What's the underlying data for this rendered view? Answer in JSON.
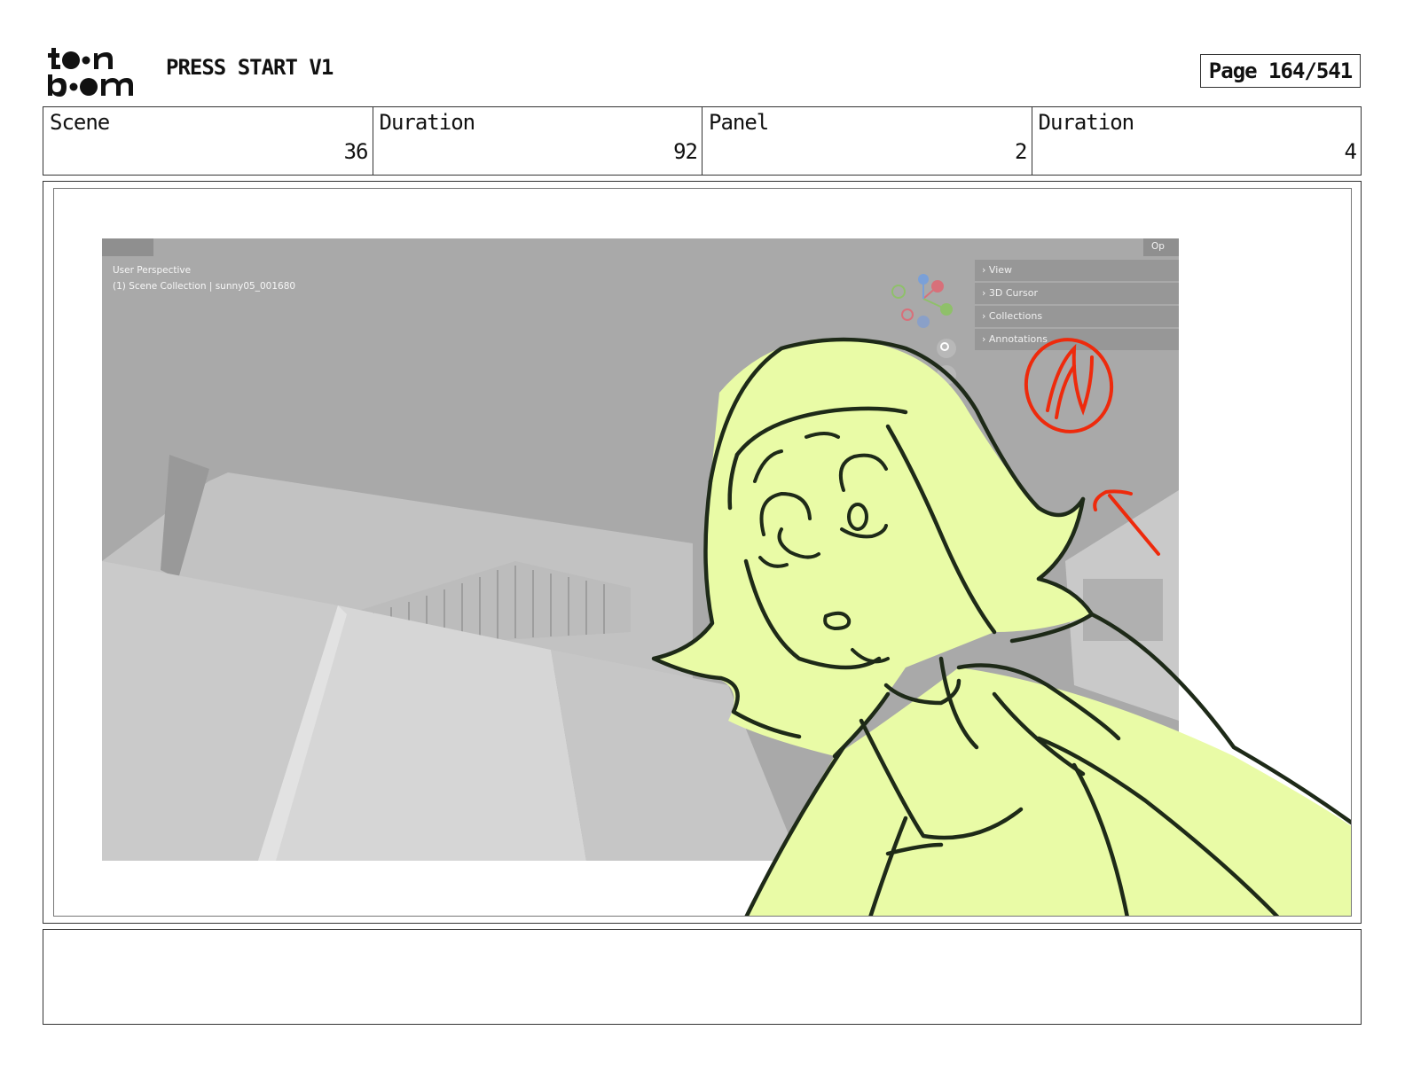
{
  "header": {
    "logo_text": "toon boom",
    "project_title": "PRESS START V1",
    "page_label": "Page 164/541"
  },
  "info": {
    "scene_label": "Scene",
    "scene_value": "36",
    "scene_duration_label": "Duration",
    "scene_duration_value": "92",
    "panel_label": "Panel",
    "panel_value": "2",
    "panel_duration_label": "Duration",
    "panel_duration_value": "4"
  },
  "viewport": {
    "perspective_label": "User Perspective",
    "collection_label": "(1) Scene Collection | sunny05_001680",
    "options_label": "Op",
    "sidebar_items": [
      "View",
      "3D Cursor",
      "Collections",
      "Annotations"
    ]
  },
  "colors": {
    "character_fill": "#e9fba6",
    "line": "#1e2a18",
    "annotation": "#ee2a0c",
    "viewport_bg": "#a8a8a8"
  },
  "notes": {
    "text": ""
  }
}
